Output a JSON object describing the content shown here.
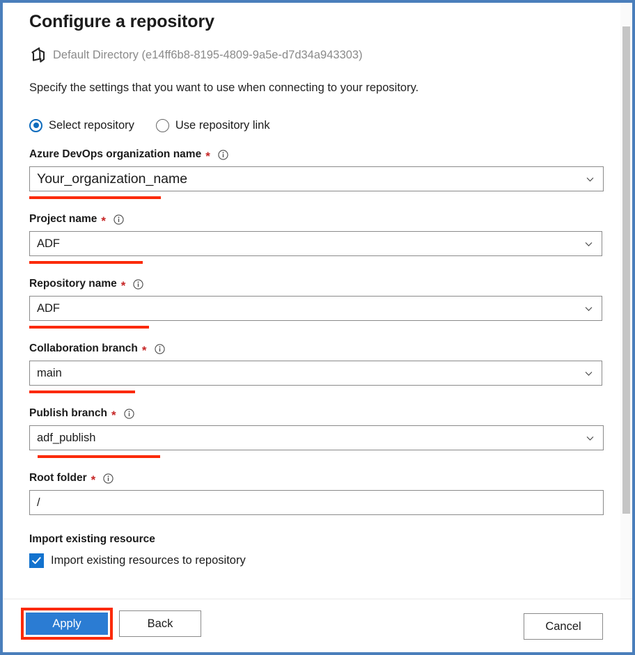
{
  "header": {
    "title": "Configure a repository",
    "directory_icon": "azure-devops-icon",
    "directory": "Default Directory (e14ff6b8-8195-4809-9a5e-d7d34a943303)",
    "subtitle": "Specify the settings that you want to use when connecting to your repository."
  },
  "repo_source": {
    "options": [
      {
        "label": "Select repository",
        "selected": true
      },
      {
        "label": "Use repository link",
        "selected": false
      }
    ]
  },
  "fields": [
    {
      "label": "Azure DevOps organization name",
      "required": "*",
      "info_icon": "info-icon",
      "value": "Your_organization_name",
      "chevron_icon": "chevron-down-icon",
      "annotated": true
    },
    {
      "label": "Project name",
      "required": "*",
      "info_icon": "info-icon",
      "value": "ADF",
      "chevron_icon": "chevron-down-icon",
      "annotated": true
    },
    {
      "label": "Repository name",
      "required": "*",
      "info_icon": "info-icon",
      "value": "ADF",
      "chevron_icon": "chevron-down-icon",
      "annotated": true
    },
    {
      "label": "Collaboration branch",
      "required": "*",
      "info_icon": "info-icon",
      "value": "main",
      "chevron_icon": "chevron-down-icon",
      "annotated": true
    },
    {
      "label": "Publish branch",
      "required": "*",
      "info_icon": "info-icon",
      "value": "adf_publish",
      "chevron_icon": "chevron-down-icon",
      "annotated": true
    },
    {
      "label": "Root folder",
      "required": "*",
      "info_icon": "info-icon",
      "value": "/",
      "chevron_icon": "",
      "annotated": false
    }
  ],
  "import_section": {
    "heading": "Import existing resource",
    "checkbox_label": "Import existing resources to repository",
    "checked": true,
    "check_icon": "checkmark-icon"
  },
  "footer": {
    "apply_label": "Apply",
    "back_label": "Back",
    "cancel_label": "Cancel"
  },
  "colors": {
    "panel_border": "#4a7ebb",
    "accent_blue": "#0f6cbd",
    "primary_button": "#2b7cd3",
    "annotation_red": "#fb2a05",
    "required_red": "#c62525",
    "muted_text": "#8a8a8a"
  }
}
